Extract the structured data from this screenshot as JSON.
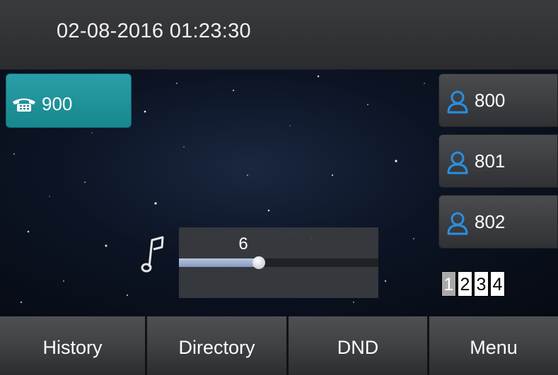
{
  "status": {
    "datetime": "02-08-2016 01:23:30"
  },
  "line_key": {
    "label": "900",
    "icon": "phone-icon"
  },
  "dss_keys": [
    {
      "label": "800",
      "icon": "contact-icon"
    },
    {
      "label": "801",
      "icon": "contact-icon"
    },
    {
      "label": "802",
      "icon": "contact-icon"
    }
  ],
  "volume": {
    "value": "6",
    "level_fraction": 0.4,
    "icon": "music-note-icon"
  },
  "pages": {
    "items": [
      "1",
      "2",
      "3",
      "4"
    ],
    "active": "1"
  },
  "softkeys": {
    "history": "History",
    "directory": "Directory",
    "dnd": "DND",
    "menu": "Menu"
  },
  "colors": {
    "accent_teal": "#1f939b",
    "contact_icon_blue": "#2a8fe0",
    "slider_fill": "#a2b1d2"
  }
}
